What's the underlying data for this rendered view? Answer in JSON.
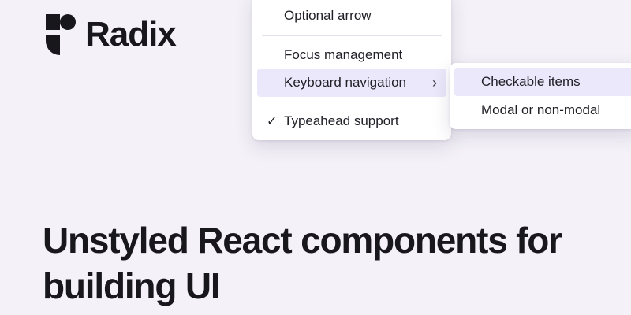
{
  "brand": {
    "name": "Radix"
  },
  "menu": {
    "items": [
      {
        "label": "Optional arrow"
      },
      {
        "label": "Focus management"
      },
      {
        "label": "Keyboard navigation",
        "has_submenu": true,
        "highlighted": true
      },
      {
        "label": "Typeahead support",
        "checked": true
      }
    ],
    "check_glyph": "✓",
    "chevron_glyph": "›"
  },
  "submenu": {
    "items": [
      {
        "label": "Checkable items",
        "highlighted": true
      },
      {
        "label": "Modal or non-modal"
      }
    ]
  },
  "hero": {
    "headline": "Unstyled React components for building UI"
  },
  "colors": {
    "background": "#f4f2f8",
    "highlight": "#ebe8fb",
    "text": "#17171c"
  }
}
